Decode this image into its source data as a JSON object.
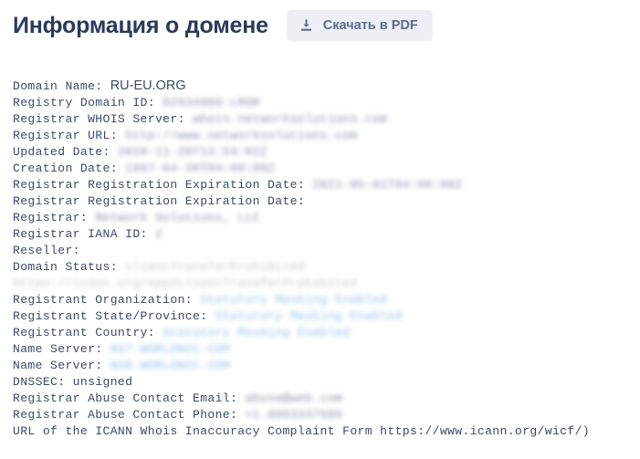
{
  "header": {
    "title": "Информация о домене",
    "download_button": {
      "label": "Скачать в PDF",
      "icon": "download-icon"
    }
  },
  "colors": {
    "title": "#2b3a5b",
    "button_bg": "#eef0f5",
    "button_text": "#5a6b8c",
    "body_text": "#3b4a6b",
    "masked_blue": "#6fa8e8",
    "page_bg": "#ffffff"
  },
  "whois": {
    "lines": [
      {
        "label": "Domain Name: ",
        "value": "RU-EU.ORG",
        "style": "sans"
      },
      {
        "label": "Registry Domain ID: ",
        "value": "D2934066-LROR",
        "style": "masked"
      },
      {
        "label": "Registrar WHOIS Server: ",
        "value": "whois.networksolutions.com",
        "style": "masked"
      },
      {
        "label": "Registrar URL: ",
        "value": "http://www.networksolutions.com",
        "style": "masked"
      },
      {
        "label": "Updated Date: ",
        "value": "2018-11-20T13:54:02Z",
        "style": "masked"
      },
      {
        "label": "Creation Date: ",
        "value": "1997-04-30T04:00:00Z",
        "style": "masked"
      },
      {
        "label": "Registrar Registration Expiration Date: ",
        "value": "2021-05-01T04:00:00Z",
        "style": "masked"
      },
      {
        "label": "Registrar Registration Expiration Date: ",
        "value": "",
        "style": "masked"
      },
      {
        "label": "Registrar: ",
        "value": "Network Solutions, LLC",
        "style": "masked"
      },
      {
        "label": "Registrar IANA ID: ",
        "value": "2",
        "style": "masked"
      },
      {
        "label": "Reseller: ",
        "value": "",
        "style": "masked"
      },
      {
        "label": "Domain Status: ",
        "value": "clientTransferProhibited https://icann.org/epp#clientTransferProhibited",
        "style": "masked-light"
      },
      {
        "label": "Registrant Organization: ",
        "value": "Statutory Masking Enabled",
        "style": "masked-blue"
      },
      {
        "label": "Registrant State/Province: ",
        "value": "Statutory Masking Enabled",
        "style": "masked-blue"
      },
      {
        "label": "Registrant Country: ",
        "value": "Statutory Masking Enabled",
        "style": "masked-blue"
      },
      {
        "label": "Name Server: ",
        "value": "NS7.WORLDNIC.COM",
        "style": "masked-blue"
      },
      {
        "label": "Name Server: ",
        "value": "NS8.WORLDNIC.COM",
        "style": "masked-blue"
      },
      {
        "label": "DNSSEC: ",
        "value": "unsigned",
        "style": "plain"
      },
      {
        "label": "Registrar Abuse Contact Email: ",
        "value": "abuse@web.com",
        "style": "masked"
      },
      {
        "label": "Registrar Abuse Contact Phone: ",
        "value": "+1.8003337680",
        "style": "masked"
      },
      {
        "label": "URL of the ICANN Whois Inaccuracy Complaint Form https://www.icann.org/wicf/)",
        "value": "",
        "style": "plain"
      }
    ]
  }
}
